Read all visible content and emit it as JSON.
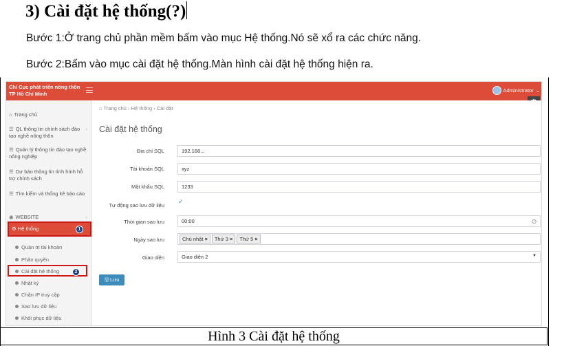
{
  "doc": {
    "heading": "3) Cài đặt hệ thống(?)",
    "step1": "Bước 1:Ở trang chủ phần mềm bấm vào mục Hệ thống.Nó sẽ xổ ra các chức năng.",
    "step2": "Bước 2:Bấm vào mục cài đặt hệ thống.Màn hình cài đặt hệ thống hiện ra.",
    "caption": "Hình 3 Cài đặt hệ thống"
  },
  "app": {
    "brand_line1": "Chi Cục phát triển nông thôn",
    "brand_line2": "TP Hồ Chí Minh",
    "user": "Administrator",
    "accent": "#dd4b39",
    "primary": "#3c8dbc"
  },
  "sidebar": {
    "home": "Trang chủ",
    "items": [
      {
        "label": "QL thông tin chính sách đào tạo nghề nông thôn"
      },
      {
        "label": "Quản lý thông tin đào tạo nghề nông nghiệp"
      },
      {
        "label": "Dự báo thông tin tình hình hỗ trợ chính sách"
      },
      {
        "label": "Tìm kiếm và thống kê báo cáo"
      }
    ],
    "website": "WEBSITE",
    "active": "Hệ thống",
    "badge1": "1",
    "badge2": "2",
    "subitems": [
      "Quản trị tài khoản",
      "Phân quyền",
      "Cài đặt hệ thống",
      "Nhật ký",
      "Chặn IP truy cập",
      "Sao lưu dữ liệu",
      "Khôi phục dữ liệu"
    ]
  },
  "breadcrumb": {
    "home": "Trang chủ",
    "section": "Hệ thống",
    "current": "Cài đặt"
  },
  "page_title": "Cài đặt hệ thống",
  "form": {
    "sql_address_label": "Địa chỉ SQL",
    "sql_address_value": "192.168...",
    "sql_account_label": "Tài khoản SQL",
    "sql_account_value": "xyz",
    "sql_password_label": "Mật khẩu SQL",
    "sql_password_value": "1233",
    "auto_backup_label": "Tự động sao lưu dữ liệu",
    "auto_backup_checked": true,
    "backup_time_label": "Thời gian sao lưu",
    "backup_time_value": "00:00",
    "backup_days_label": "Ngày sao lưu",
    "backup_days": [
      "Chủ nhật",
      "Thứ 3",
      "Thứ 5"
    ],
    "theme_label": "Giao diện",
    "theme_value": "Giao diện 2",
    "save_label": "Lưu"
  }
}
